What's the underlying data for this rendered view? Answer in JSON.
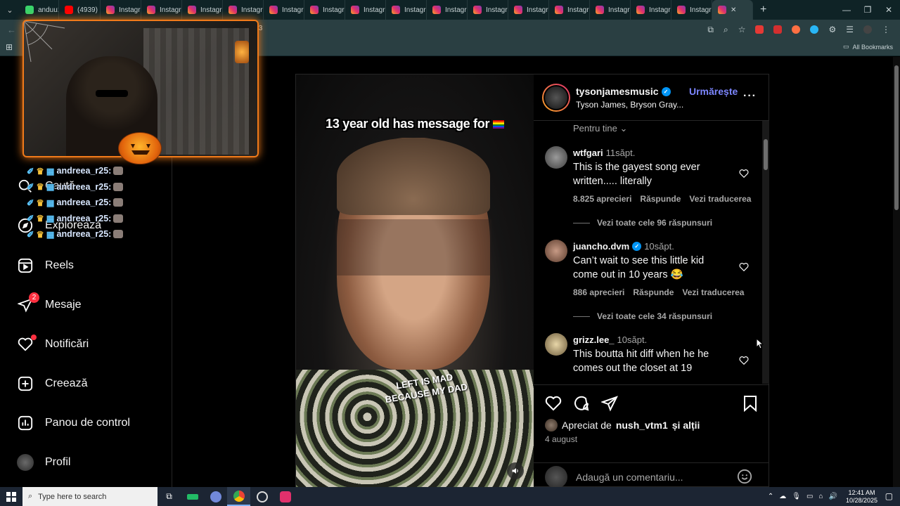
{
  "browser": {
    "tabs": [
      {
        "label": "anduu1",
        "icon": "twitch-icon",
        "kind": "green"
      },
      {
        "label": "(4939)",
        "icon": "youtube-icon",
        "kind": "yt"
      },
      {
        "label": "Instagr",
        "icon": "instagram-icon",
        "kind": "ig"
      },
      {
        "label": "Instagr",
        "icon": "instagram-icon",
        "kind": "ig"
      },
      {
        "label": "Instagr",
        "icon": "instagram-icon",
        "kind": "ig"
      },
      {
        "label": "Instagr",
        "icon": "instagram-icon",
        "kind": "ig"
      },
      {
        "label": "Instagr",
        "icon": "instagram-icon",
        "kind": "ig"
      },
      {
        "label": "Instagr",
        "icon": "instagram-icon",
        "kind": "ig"
      },
      {
        "label": "Instagr",
        "icon": "instagram-icon",
        "kind": "ig"
      },
      {
        "label": "Instagr",
        "icon": "instagram-icon",
        "kind": "ig"
      },
      {
        "label": "Instagr",
        "icon": "instagram-icon",
        "kind": "ig"
      },
      {
        "label": "Instagr",
        "icon": "instagram-icon",
        "kind": "ig"
      },
      {
        "label": "Instagr",
        "icon": "instagram-icon",
        "kind": "ig"
      },
      {
        "label": "Instagr",
        "icon": "instagram-icon",
        "kind": "ig"
      },
      {
        "label": "Instagr",
        "icon": "instagram-icon",
        "kind": "ig"
      },
      {
        "label": "Instagr",
        "icon": "instagram-icon",
        "kind": "ig"
      },
      {
        "label": "Instagr",
        "icon": "instagram-icon",
        "kind": "ig"
      },
      {
        "label": "Instagr",
        "icon": "instagram-icon",
        "kind": "ig"
      }
    ],
    "url_fragment": "Q3",
    "all_bookmarks": "All Bookmarks"
  },
  "sidebar": {
    "items": [
      {
        "label": "Caută",
        "icon": "search-icon"
      },
      {
        "label": "Explorează",
        "icon": "compass-icon"
      },
      {
        "label": "Reels",
        "icon": "reels-icon"
      },
      {
        "label": "Mesaje",
        "icon": "messenger-icon",
        "badge": "2"
      },
      {
        "label": "Notificări",
        "icon": "heart-icon",
        "dot": true
      },
      {
        "label": "Creează",
        "icon": "plus-square-icon"
      },
      {
        "label": "Panou de control",
        "icon": "dashboard-icon"
      },
      {
        "label": "Profil",
        "icon": "profile-avatar"
      }
    ]
  },
  "overlay": {
    "chat": [
      "andreea_r25:",
      "andreea_r25:",
      "andreea_r25:",
      "andreea_r25:",
      "andreea_r25:"
    ]
  },
  "post": {
    "video_caption": "13 year old has message for",
    "sticker_text": "LEFT IS MAD BECAUSE MY DAD",
    "username": "tysonjamesmusic",
    "follow_label": "Urmărește",
    "subtitle": "Tyson James, Bryson Gray...",
    "sort_label": "Pentru tine",
    "comments": [
      {
        "user": "wtfgari",
        "age": "11săpt.",
        "verified": false,
        "text": "This is the gayest song ever written..... literally",
        "likes": "8.825 aprecieri",
        "reply": "Răspunde",
        "translate": "Vezi traducerea",
        "replies": "Vezi toate cele 96 răspunsuri"
      },
      {
        "user": "juancho.dvm",
        "age": "10săpt.",
        "verified": true,
        "text": "Can’t wait to see this little kid come out in 10 years 😂",
        "likes": "886 aprecieri",
        "reply": "Răspunde",
        "translate": "Vezi traducerea",
        "replies": "Vezi toate cele 34 răspunsuri"
      },
      {
        "user": "grizz.lee_",
        "age": "10săpt.",
        "verified": false,
        "text": "This boutta hit diff when he he comes out the closet at 19",
        "likes": "",
        "reply": "",
        "translate": "",
        "replies": ""
      }
    ],
    "liked_prefix": "Apreciat de",
    "liked_user": "nush_vtm1",
    "liked_suffix": "și alții",
    "date": "4 august",
    "comment_placeholder": "Adaugă un comentariu..."
  },
  "taskbar": {
    "search_placeholder": "Type here to search",
    "time": "12:41 AM",
    "date": "10/28/2025"
  },
  "colors": {
    "accent": "#7c86ff",
    "badge": "#ff3040",
    "verified": "#0095f6",
    "overlay_border": "#f07a1a"
  }
}
